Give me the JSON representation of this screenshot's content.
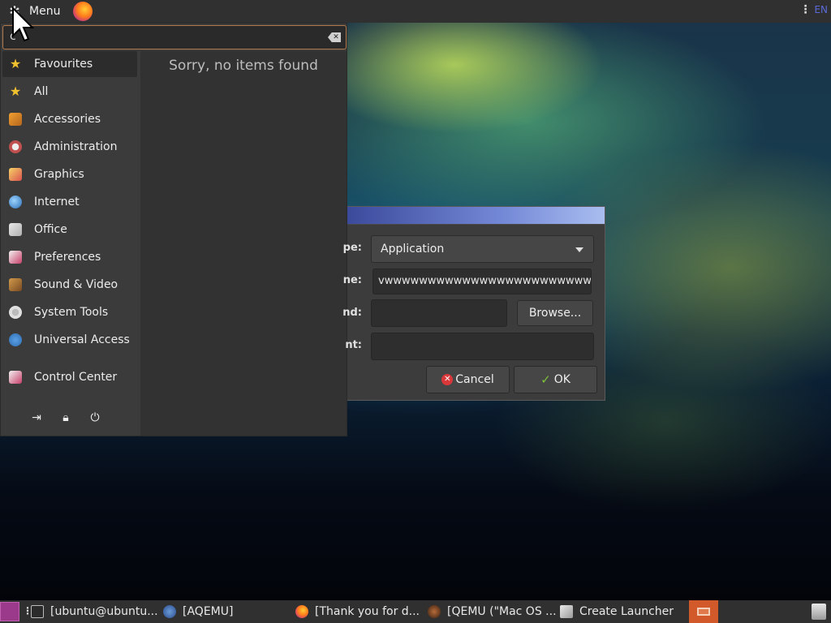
{
  "top_panel": {
    "menu_label": "Menu",
    "lang_indicator": "EN"
  },
  "menu": {
    "search_value": "c",
    "no_items_text": "Sorry, no items found",
    "categories": [
      {
        "label": "Favourites",
        "icon": "star-icon"
      },
      {
        "label": "All",
        "icon": "star-icon"
      },
      {
        "label": "Accessories",
        "icon": "accessories-icon"
      },
      {
        "label": "Administration",
        "icon": "administration-icon"
      },
      {
        "label": "Graphics",
        "icon": "graphics-icon"
      },
      {
        "label": "Internet",
        "icon": "internet-icon"
      },
      {
        "label": "Office",
        "icon": "office-icon"
      },
      {
        "label": "Preferences",
        "icon": "preferences-icon"
      },
      {
        "label": "Sound & Video",
        "icon": "sound-video-icon"
      },
      {
        "label": "System Tools",
        "icon": "system-tools-icon"
      },
      {
        "label": "Universal Access",
        "icon": "universal-access-icon"
      },
      {
        "label": "Control Center",
        "icon": "control-center-icon"
      }
    ],
    "actions": [
      "logout-icon",
      "lock-icon",
      "power-icon"
    ]
  },
  "dialog": {
    "type_label_fragment": "pe:",
    "type_value": "Application",
    "name_label_fragment": "ne:",
    "name_value": "vwwwwwwwwwwwwwwwwwwwwwwwwww",
    "command_label_fragment": "nd:",
    "command_value": "",
    "browse_label": "Browse...",
    "comment_label_fragment": "nt:",
    "comment_value": "",
    "cancel_label": "Cancel",
    "ok_label": "OK"
  },
  "taskbar": {
    "tasks": [
      {
        "label": "[ubuntu@ubuntu...",
        "icon": "terminal-icon"
      },
      {
        "label": "[AQEMU]",
        "icon": "qemu-icon"
      },
      {
        "label": "[Thank you for d...",
        "icon": "firefox-icon"
      },
      {
        "label": "[QEMU (\"Mac OS ...",
        "icon": "qemu-macos-icon"
      },
      {
        "label": "Create Launcher",
        "icon": "launcher-icon"
      }
    ]
  },
  "colors": {
    "panel_bg": "#303030",
    "menu_bg": "#3b3b3b",
    "search_border": "#b07a4a",
    "dialog_title_gradient_end": "#a9bdf0",
    "workspace_orange": "#d25a2a"
  }
}
